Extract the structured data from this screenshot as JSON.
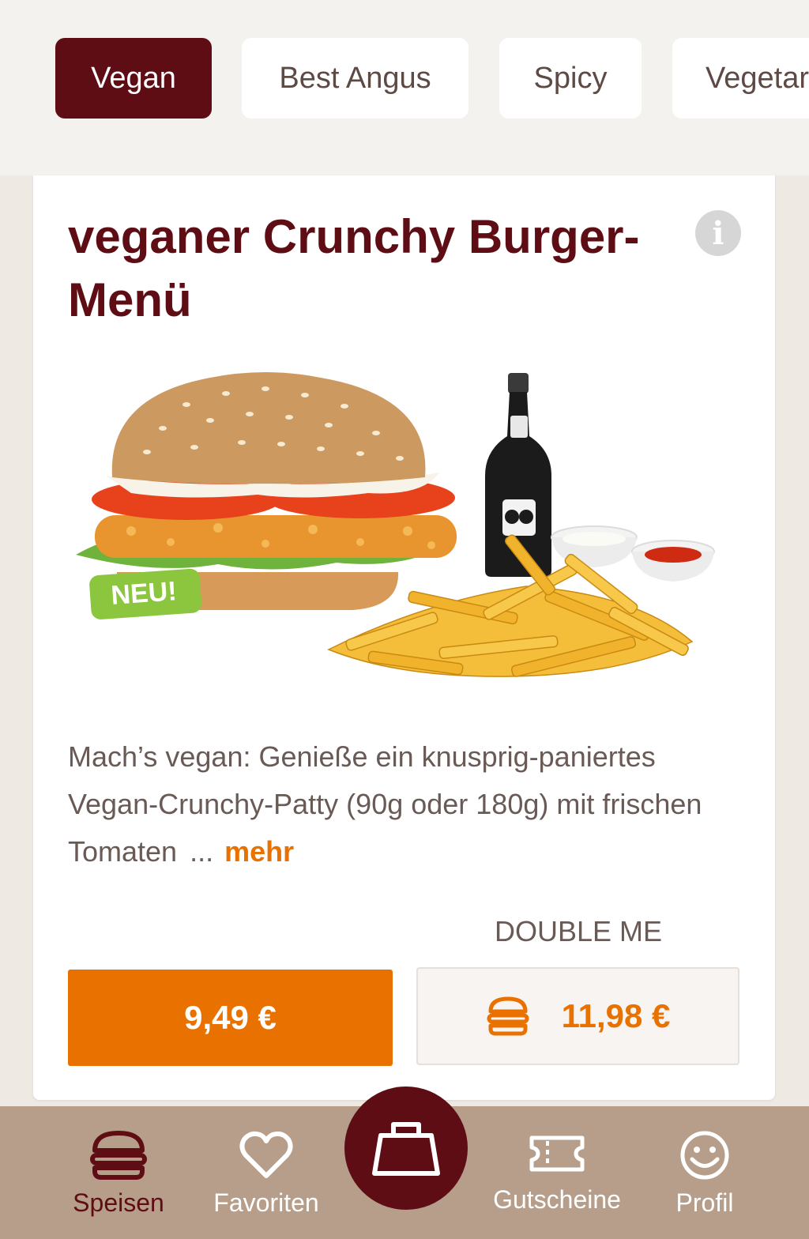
{
  "tabs": [
    {
      "label": "Vegan",
      "active": true
    },
    {
      "label": "Best Angus",
      "active": false
    },
    {
      "label": "Spicy",
      "active": false
    },
    {
      "label": "Vegetar",
      "active": false
    }
  ],
  "product": {
    "title": "veganer Crunchy Burger-Menü",
    "badge": "NEU!",
    "description": "Mach’s vegan: Genieße ein knusprig-paniertes Vegan-Crunchy-Patty (90g oder 180g) mit frischen Tomaten",
    "ellipsis": "...",
    "more_label": "mehr",
    "price": "9,49 €",
    "double_label": "DOUBLE ME",
    "double_price": "11,98 €"
  },
  "nav": {
    "speisen": "Speisen",
    "favoriten": "Favoriten",
    "gutscheine": "Gutscheine",
    "profil": "Profil"
  },
  "colors": {
    "brand": "#5e0d14",
    "accent": "#e87100",
    "nav_bg": "#b79e8a",
    "badge": "#8cc63f"
  }
}
